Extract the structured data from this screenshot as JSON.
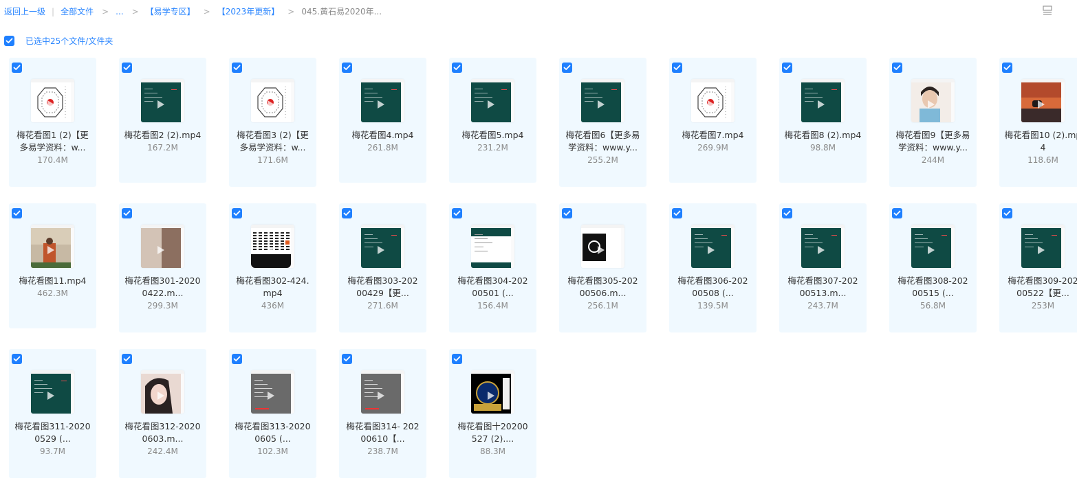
{
  "breadcrumb": {
    "back": "返回上一级",
    "all_files": "全部文件",
    "ellipsis": "...",
    "folder_1": "【易学专区】",
    "folder_2": "【2023年更新】",
    "current": "045.黄石易2020年..."
  },
  "selection": {
    "label": "已选中25个文件/文件夹"
  },
  "colors": {
    "accent": "#1f80ff",
    "card_bg": "#f0f9ff",
    "slide_green": "#0f4a44"
  },
  "files": [
    {
      "name_l1": "梅花看图1 (2)【更",
      "name_l2": "多易学资料：w...",
      "size": "170.4M",
      "thumb": "bagua-chart",
      "type": "video"
    },
    {
      "name_l1": "梅花看图2 (2).mp4",
      "name_l2": "",
      "size": "167.2M",
      "thumb": "green-slide",
      "type": "video"
    },
    {
      "name_l1": "梅花看图3 (2)【更",
      "name_l2": "多易学资料：w...",
      "size": "171.6M",
      "thumb": "bagua-chart",
      "type": "video"
    },
    {
      "name_l1": "梅花看图4.mp4",
      "name_l2": "",
      "size": "261.8M",
      "thumb": "green-slide",
      "type": "video"
    },
    {
      "name_l1": "梅花看图5.mp4",
      "name_l2": "",
      "size": "231.2M",
      "thumb": "green-slide",
      "type": "video"
    },
    {
      "name_l1": "梅花看图6【更多易",
      "name_l2": "学资料：www.y...",
      "size": "255.2M",
      "thumb": "green-slide",
      "type": "video"
    },
    {
      "name_l1": "梅花看图7.mp4",
      "name_l2": "",
      "size": "269.9M",
      "thumb": "bagua-chart",
      "type": "video"
    },
    {
      "name_l1": "梅花看图8 (2).mp4",
      "name_l2": "",
      "size": "98.8M",
      "thumb": "green-slide",
      "type": "video"
    },
    {
      "name_l1": "梅花看图9【更多易",
      "name_l2": "学资料：www.y...",
      "size": "244M",
      "thumb": "person-photo",
      "type": "video"
    },
    {
      "name_l1": "梅花看图10 (2).mp",
      "name_l2": "4",
      "size": "118.6M",
      "thumb": "sunset-photo",
      "type": "video"
    },
    {
      "name_l1": "梅花看图11.mp4",
      "name_l2": "",
      "size": "462.3M",
      "thumb": "street-photo",
      "type": "video"
    },
    {
      "name_l1": "梅花看图301-2020",
      "name_l2": "0422.m...",
      "size": "299.3M",
      "thumb": "stair-photo",
      "type": "video"
    },
    {
      "name_l1": "梅花看图302-424.",
      "name_l2": "mp4",
      "size": "436M",
      "thumb": "bw-chart",
      "type": "video"
    },
    {
      "name_l1": "梅花看图303-202",
      "name_l2": "00429【更...",
      "size": "271.6M",
      "thumb": "green-slide",
      "type": "video"
    },
    {
      "name_l1": "梅花看图304-202",
      "name_l2": "00501 (...",
      "size": "156.4M",
      "thumb": "doc-slide",
      "type": "video"
    },
    {
      "name_l1": "梅花看图305-202",
      "name_l2": "00506.m...",
      "size": "256.1M",
      "thumb": "black-chart",
      "type": "video"
    },
    {
      "name_l1": "梅花看图306-202",
      "name_l2": "00508 (...",
      "size": "139.5M",
      "thumb": "green-slide",
      "type": "video"
    },
    {
      "name_l1": "梅花看图307-202",
      "name_l2": "00513.m...",
      "size": "243.7M",
      "thumb": "green-slide",
      "type": "video"
    },
    {
      "name_l1": "梅花看图308-202",
      "name_l2": "00515 (...",
      "size": "56.8M",
      "thumb": "green-slide",
      "type": "video"
    },
    {
      "name_l1": "梅花看图309-202",
      "name_l2": "00522【更...",
      "size": "253M",
      "thumb": "green-slide",
      "type": "video"
    },
    {
      "name_l1": "梅花看图311-2020",
      "name_l2": "0529 (...",
      "size": "93.7M",
      "thumb": "green-slide",
      "type": "video"
    },
    {
      "name_l1": "梅花看图312-2020",
      "name_l2": "0603.m...",
      "size": "242.4M",
      "thumb": "woman-photo",
      "type": "video"
    },
    {
      "name_l1": "梅花看图313-2020",
      "name_l2": "0605 (...",
      "size": "102.3M",
      "thumb": "gray-slide",
      "type": "video"
    },
    {
      "name_l1": "梅花看图314- 202",
      "name_l2": "00610【...",
      "size": "238.7M",
      "thumb": "gray-slide",
      "type": "video"
    },
    {
      "name_l1": "梅花看图十20200",
      "name_l2": "527 (2)....",
      "size": "88.3M",
      "thumb": "inter-logo",
      "type": "video"
    }
  ]
}
